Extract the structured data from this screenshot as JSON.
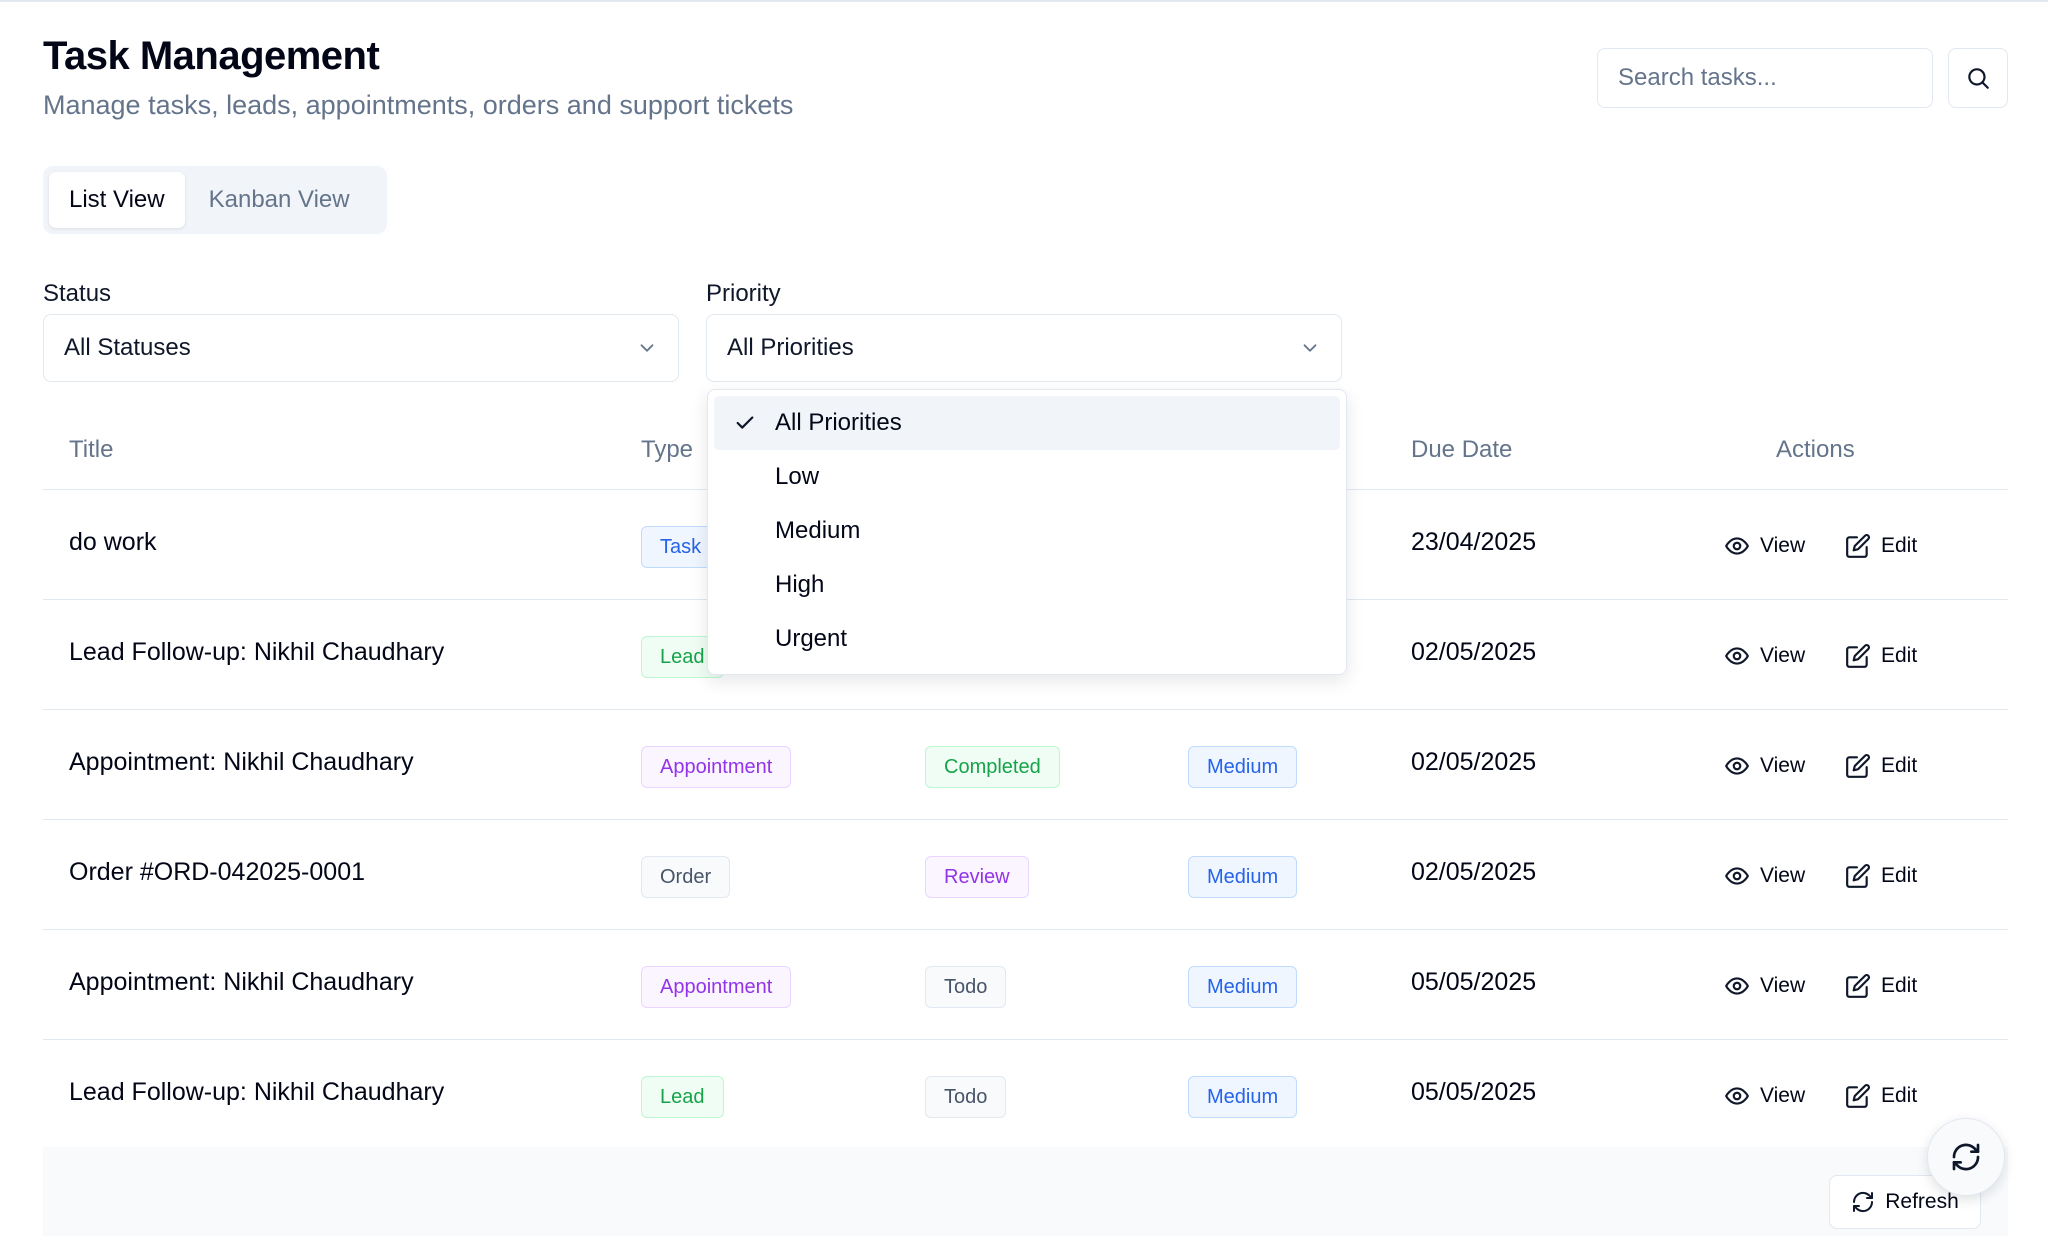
{
  "header": {
    "title": "Task Management",
    "subtitle": "Manage tasks, leads, appointments, orders and support tickets"
  },
  "search": {
    "placeholder": "Search tasks...",
    "value": ""
  },
  "views": {
    "list_label": "List View",
    "kanban_label": "Kanban View",
    "active": "List View"
  },
  "filters": {
    "status": {
      "label": "Status",
      "value": "All Statuses"
    },
    "priority": {
      "label": "Priority",
      "value": "All Priorities"
    }
  },
  "table": {
    "columns": {
      "title": "Title",
      "type": "Type",
      "due_date": "Due Date",
      "actions": "Actions"
    },
    "view_label": "View",
    "edit_label": "Edit",
    "rows": [
      {
        "title": "do work",
        "type": "Task",
        "status": "",
        "priority": "",
        "due": "23/04/2025"
      },
      {
        "title": "Lead Follow-up: Nikhil Chaudhary",
        "type": "Lead",
        "status": "",
        "priority": "",
        "due": "02/05/2025"
      },
      {
        "title": "Appointment: Nikhil Chaudhary",
        "type": "Appointment",
        "status": "Completed",
        "priority": "Medium",
        "due": "02/05/2025"
      },
      {
        "title": "Order #ORD-042025-0001",
        "type": "Order",
        "status": "Review",
        "priority": "Medium",
        "due": "02/05/2025"
      },
      {
        "title": "Appointment: Nikhil Chaudhary",
        "type": "Appointment",
        "status": "Todo",
        "priority": "Medium",
        "due": "05/05/2025"
      },
      {
        "title": "Lead Follow-up: Nikhil Chaudhary",
        "type": "Lead",
        "status": "Todo",
        "priority": "Medium",
        "due": "05/05/2025"
      }
    ]
  },
  "priority_dropdown": {
    "selected": "All Priorities",
    "options": [
      "All Priorities",
      "Low",
      "Medium",
      "High",
      "Urgent"
    ]
  },
  "footer": {
    "refresh_label": "Refresh"
  },
  "colors": {
    "task_type": "#2563eb",
    "lead_type": "#16a34a",
    "appointment_type": "#9333ea",
    "order_type": "#475569",
    "completed_status": "#16a34a",
    "review_status": "#9333ea",
    "todo_status": "#475569",
    "medium_priority": "#2563eb"
  },
  "icons": {
    "search": "search-icon",
    "select": "chevron-down-icon",
    "view": "eye-icon",
    "edit": "edit-icon",
    "refresh": "refresh-icon",
    "check": "check-icon"
  }
}
